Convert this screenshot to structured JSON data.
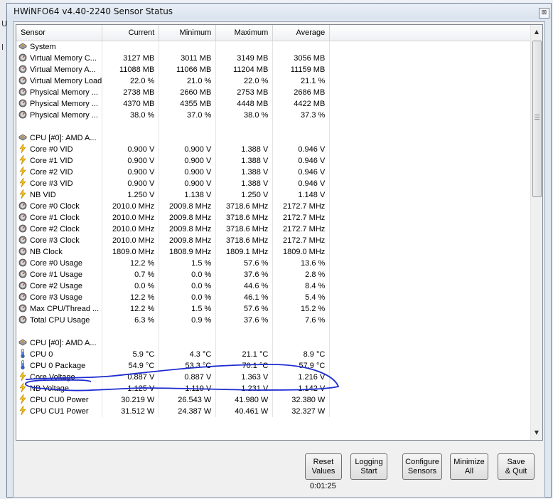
{
  "window": {
    "title": "HWiNFO64 v4.40-2240 Sensor Status",
    "close_glyph": "⊠"
  },
  "background": {
    "letter_1": "U",
    "letter_2": "l"
  },
  "columns": [
    "Sensor",
    "Current",
    "Minimum",
    "Maximum",
    "Average"
  ],
  "rows": [
    {
      "type": "group",
      "icon": "sensor-group-icon",
      "name": "System"
    },
    {
      "type": "item",
      "icon": "clock-gauge-icon",
      "name": "Virtual Memory C...",
      "cur": "3127 MB",
      "min": "3011 MB",
      "max": "3149 MB",
      "avg": "3056 MB"
    },
    {
      "type": "item",
      "icon": "clock-gauge-icon",
      "name": "Virtual Memory A...",
      "cur": "11088 MB",
      "min": "11066 MB",
      "max": "11204 MB",
      "avg": "11159 MB"
    },
    {
      "type": "item",
      "icon": "clock-gauge-icon",
      "name": "Virtual Memory Load",
      "cur": "22.0 %",
      "min": "21.0 %",
      "max": "22.0 %",
      "avg": "21.1 %"
    },
    {
      "type": "item",
      "icon": "clock-gauge-icon",
      "name": "Physical Memory ...",
      "cur": "2738 MB",
      "min": "2660 MB",
      "max": "2753 MB",
      "avg": "2686 MB"
    },
    {
      "type": "item",
      "icon": "clock-gauge-icon",
      "name": "Physical Memory ...",
      "cur": "4370 MB",
      "min": "4355 MB",
      "max": "4448 MB",
      "avg": "4422 MB"
    },
    {
      "type": "item",
      "icon": "clock-gauge-icon",
      "name": "Physical Memory ...",
      "cur": "38.0 %",
      "min": "37.0 %",
      "max": "38.0 %",
      "avg": "37.3 %"
    },
    {
      "type": "blank"
    },
    {
      "type": "group",
      "icon": "sensor-group-icon",
      "name": "CPU [#0]: AMD A..."
    },
    {
      "type": "item",
      "icon": "lightning-icon",
      "name": "Core #0 VID",
      "cur": "0.900 V",
      "min": "0.900 V",
      "max": "1.388 V",
      "avg": "0.946 V"
    },
    {
      "type": "item",
      "icon": "lightning-icon",
      "name": "Core #1 VID",
      "cur": "0.900 V",
      "min": "0.900 V",
      "max": "1.388 V",
      "avg": "0.946 V"
    },
    {
      "type": "item",
      "icon": "lightning-icon",
      "name": "Core #2 VID",
      "cur": "0.900 V",
      "min": "0.900 V",
      "max": "1.388 V",
      "avg": "0.946 V"
    },
    {
      "type": "item",
      "icon": "lightning-icon",
      "name": "Core #3 VID",
      "cur": "0.900 V",
      "min": "0.900 V",
      "max": "1.388 V",
      "avg": "0.946 V"
    },
    {
      "type": "item",
      "icon": "lightning-icon",
      "name": "NB VID",
      "cur": "1.250 V",
      "min": "1.138 V",
      "max": "1.250 V",
      "avg": "1.148 V"
    },
    {
      "type": "item",
      "icon": "clock-gauge-icon",
      "name": "Core #0 Clock",
      "cur": "2010.0 MHz",
      "min": "2009.8 MHz",
      "max": "3718.6 MHz",
      "avg": "2172.7 MHz"
    },
    {
      "type": "item",
      "icon": "clock-gauge-icon",
      "name": "Core #1 Clock",
      "cur": "2010.0 MHz",
      "min": "2009.8 MHz",
      "max": "3718.6 MHz",
      "avg": "2172.7 MHz"
    },
    {
      "type": "item",
      "icon": "clock-gauge-icon",
      "name": "Core #2 Clock",
      "cur": "2010.0 MHz",
      "min": "2009.8 MHz",
      "max": "3718.6 MHz",
      "avg": "2172.7 MHz"
    },
    {
      "type": "item",
      "icon": "clock-gauge-icon",
      "name": "Core #3 Clock",
      "cur": "2010.0 MHz",
      "min": "2009.8 MHz",
      "max": "3718.6 MHz",
      "avg": "2172.7 MHz"
    },
    {
      "type": "item",
      "icon": "clock-gauge-icon",
      "name": "NB Clock",
      "cur": "1809.0 MHz",
      "min": "1808.9 MHz",
      "max": "1809.1 MHz",
      "avg": "1809.0 MHz"
    },
    {
      "type": "item",
      "icon": "clock-gauge-icon",
      "name": "Core #0 Usage",
      "cur": "12.2 %",
      "min": "1.5 %",
      "max": "57.6 %",
      "avg": "13.6 %"
    },
    {
      "type": "item",
      "icon": "clock-gauge-icon",
      "name": "Core #1 Usage",
      "cur": "0.7 %",
      "min": "0.0 %",
      "max": "37.6 %",
      "avg": "2.8 %"
    },
    {
      "type": "item",
      "icon": "clock-gauge-icon",
      "name": "Core #2 Usage",
      "cur": "0.0 %",
      "min": "0.0 %",
      "max": "44.6 %",
      "avg": "8.4 %"
    },
    {
      "type": "item",
      "icon": "clock-gauge-icon",
      "name": "Core #3 Usage",
      "cur": "12.2 %",
      "min": "0.0 %",
      "max": "46.1 %",
      "avg": "5.4 %"
    },
    {
      "type": "item",
      "icon": "clock-gauge-icon",
      "name": "Max CPU/Thread ...",
      "cur": "12.2 %",
      "min": "1.5 %",
      "max": "57.6 %",
      "avg": "15.2 %"
    },
    {
      "type": "item",
      "icon": "clock-gauge-icon",
      "name": "Total CPU Usage",
      "cur": "6.3 %",
      "min": "0.9 %",
      "max": "37.6 %",
      "avg": "7.6 %"
    },
    {
      "type": "blank"
    },
    {
      "type": "group",
      "icon": "sensor-group-icon",
      "name": "CPU [#0]: AMD A..."
    },
    {
      "type": "item",
      "icon": "thermometer-icon",
      "name": "CPU 0",
      "cur": "5.9 °C",
      "min": "4.3 °C",
      "max": "21.1 °C",
      "avg": "8.9 °C"
    },
    {
      "type": "item",
      "icon": "thermometer-icon",
      "name": "CPU 0 Package",
      "cur": "54.9 °C",
      "min": "53.3 °C",
      "max": "70.1 °C",
      "avg": "57.9 °C"
    },
    {
      "type": "item",
      "icon": "lightning-icon",
      "name": "Core Voltage",
      "cur": "0.887 V",
      "min": "0.887 V",
      "max": "1.363 V",
      "avg": "1.216 V"
    },
    {
      "type": "item",
      "icon": "lightning-icon",
      "name": "NB Voltage",
      "cur": "1.125 V",
      "min": "1.119 V",
      "max": "1.231 V",
      "avg": "1.142 V"
    },
    {
      "type": "item",
      "icon": "lightning-icon",
      "name": "CPU CU0 Power",
      "cur": "30.219 W",
      "min": "26.543 W",
      "max": "41.980 W",
      "avg": "32.380 W"
    },
    {
      "type": "item",
      "icon": "lightning-icon",
      "name": "CPU CU1 Power",
      "cur": "31.512 W",
      "min": "24.387 W",
      "max": "40.461 W",
      "avg": "32.327 W"
    }
  ],
  "buttons": {
    "reset": [
      "Reset",
      "Values"
    ],
    "logging": [
      "Logging",
      "Start"
    ],
    "configure": [
      "Configure",
      "Sensors"
    ],
    "minimize": [
      "Minimize",
      "All"
    ],
    "save": [
      "Save",
      "& Quit"
    ]
  },
  "timer": "0:01:25",
  "colors": {
    "annotation_ink": "#1d2bd0",
    "lightning": "#f0c020",
    "gauge": "#6b6b6b"
  }
}
